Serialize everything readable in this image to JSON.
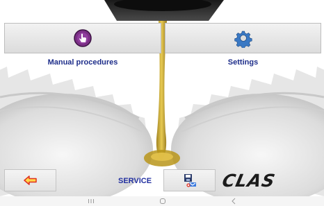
{
  "main": {
    "manual_label": "Manual procedures",
    "settings_label": "Settings",
    "service_label": "SERVICE"
  },
  "brand": {
    "logo_text": "CLAS"
  },
  "icons": {
    "manual": "hand-touch-icon",
    "settings": "gear-icon",
    "back": "arrow-left-icon",
    "save": "save-disk-icon"
  },
  "colors": {
    "label_blue": "#1e2e8a",
    "back_arrow": "#e0301e",
    "manual_icon_purple": "#7b2f86",
    "settings_icon_blue": "#3a79c4",
    "oil": "#c9a227"
  }
}
